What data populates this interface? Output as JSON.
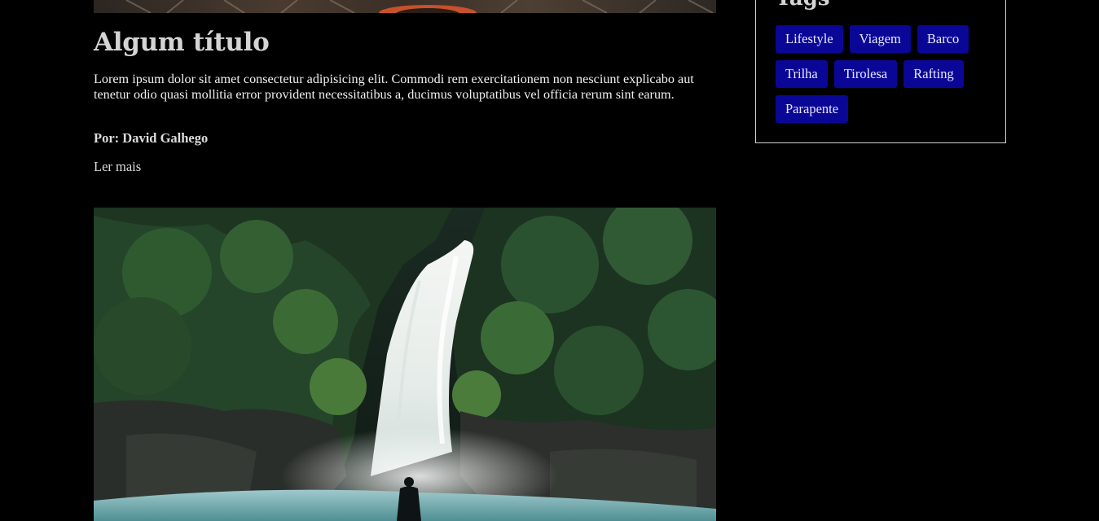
{
  "post": {
    "title": "Algum título",
    "body": "Lorem ipsum dolor sit amet consectetur adipisicing elit. Commodi rem exercitationem non nesciunt explicabo aut tenetur odio quasi mollitia error provident necessitatibus a, ducimus voluptatibus vel officia rerum sint earum.",
    "author": "Por: David Galhego",
    "read_more": "Ler mais"
  },
  "sidebar": {
    "heading": "Tags",
    "tags": [
      "Lifestyle",
      "Viagem",
      "Barco",
      "Trilha",
      "Tirolesa",
      "Rafting",
      "Parapente"
    ]
  },
  "colors": {
    "background": "#000000",
    "tag_background": "#0b0796",
    "border": "#cfcfcf"
  }
}
